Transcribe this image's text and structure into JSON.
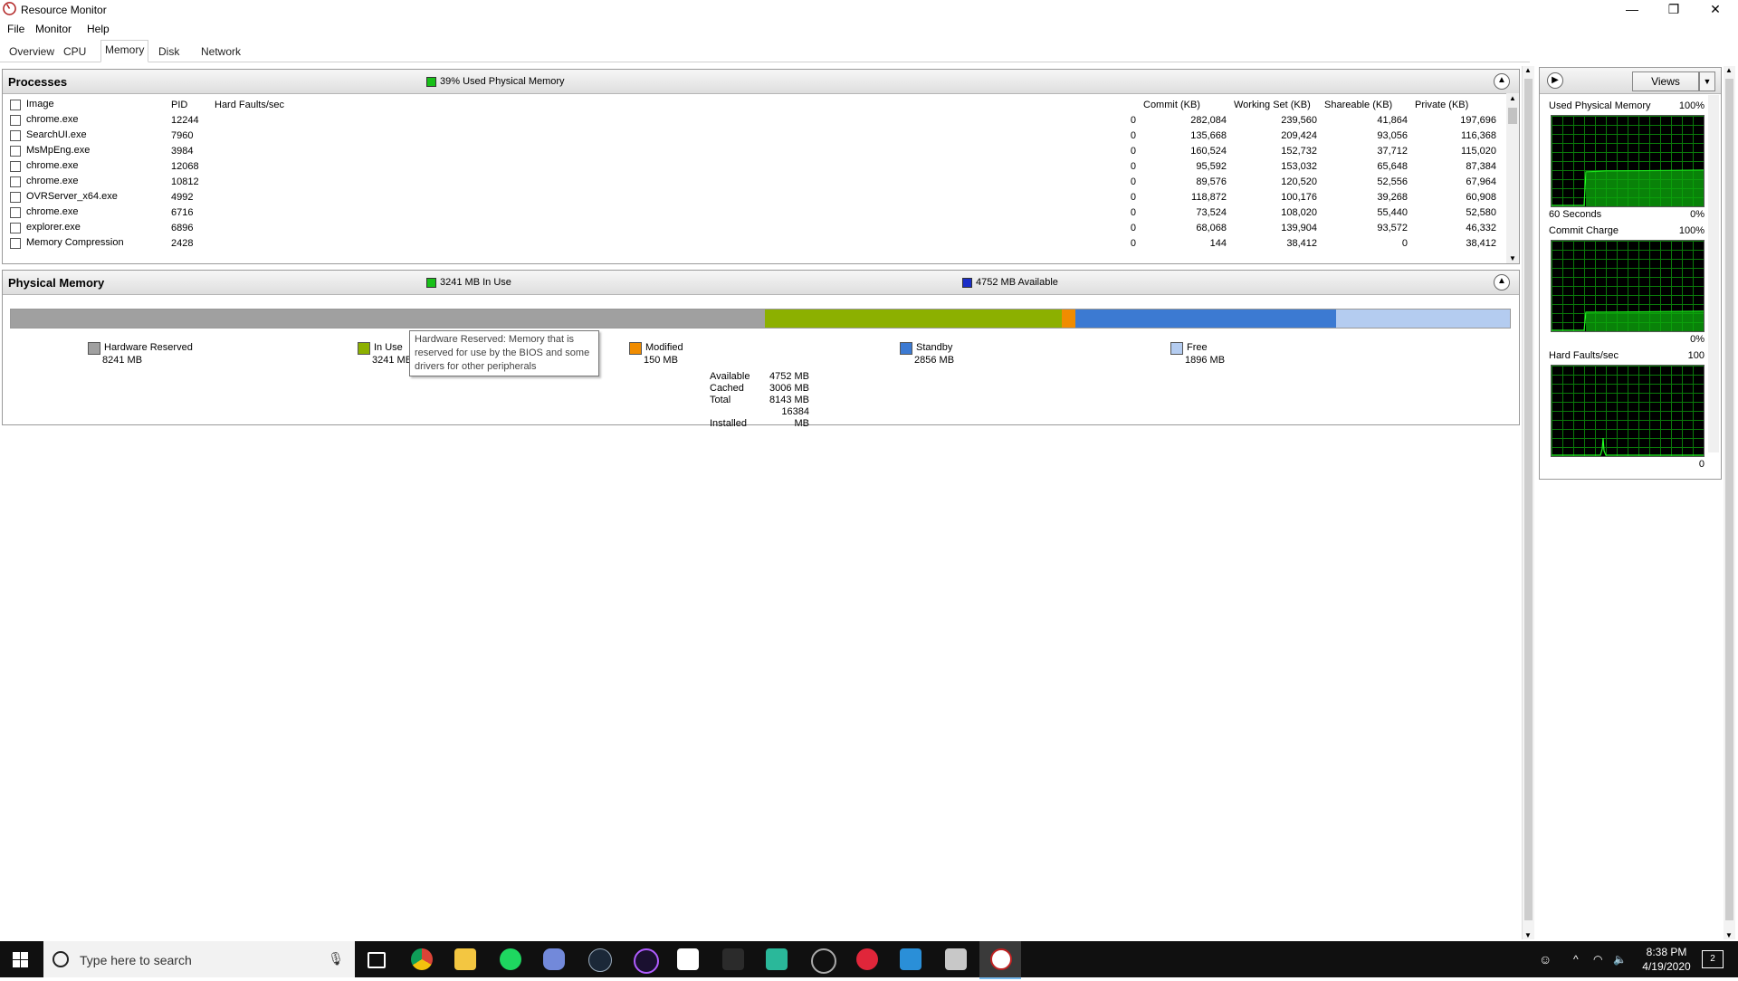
{
  "window": {
    "title": "Resource Monitor",
    "buttons": {
      "minimize": "—",
      "restore": "❐",
      "close": "✕"
    }
  },
  "menu": [
    "File",
    "Monitor",
    "Help"
  ],
  "tabs": [
    "Overview",
    "CPU",
    "Memory",
    "Disk",
    "Network"
  ],
  "active_tab": "Memory",
  "processes": {
    "title": "Processes",
    "status": "39% Used Physical Memory",
    "columns": [
      "Image",
      "PID",
      "Hard Faults/sec",
      "Commit (KB)",
      "Working Set (KB)",
      "Shareable (KB)",
      "Private (KB)"
    ],
    "rows": [
      [
        "chrome.exe",
        "12244",
        "0",
        "282,084",
        "239,560",
        "41,864",
        "197,696"
      ],
      [
        "SearchUI.exe",
        "7960",
        "0",
        "135,668",
        "209,424",
        "93,056",
        "116,368"
      ],
      [
        "MsMpEng.exe",
        "3984",
        "0",
        "160,524",
        "152,732",
        "37,712",
        "115,020"
      ],
      [
        "chrome.exe",
        "12068",
        "0",
        "95,592",
        "153,032",
        "65,648",
        "87,384"
      ],
      [
        "chrome.exe",
        "10812",
        "0",
        "89,576",
        "120,520",
        "52,556",
        "67,964"
      ],
      [
        "OVRServer_x64.exe",
        "4992",
        "0",
        "118,872",
        "100,176",
        "39,268",
        "60,908"
      ],
      [
        "chrome.exe",
        "6716",
        "0",
        "73,524",
        "108,020",
        "55,440",
        "52,580"
      ],
      [
        "explorer.exe",
        "6896",
        "0",
        "68,068",
        "139,904",
        "93,572",
        "46,332"
      ],
      [
        "Memory Compression",
        "2428",
        "0",
        "144",
        "38,412",
        "0",
        "38,412"
      ]
    ]
  },
  "physical_memory": {
    "title": "Physical Memory",
    "in_use_status": "3241 MB In Use",
    "available_status": "4752 MB Available",
    "colors": {
      "hardware_reserved": "#a0a0a0",
      "in_use": "#8cb000",
      "modified": "#f08c00",
      "standby": "#3c7ad2",
      "free": "#b4ccf0"
    },
    "bar_fractions": {
      "hardware_reserved": 0.503,
      "in_use": 0.198,
      "modified": 0.009,
      "standby": 0.174,
      "free": 0.116
    },
    "legend": [
      {
        "key": "hardware_reserved",
        "label": "Hardware Reserved",
        "value": "8241 MB"
      },
      {
        "key": "in_use",
        "label": "In Use",
        "value": "3241 MB"
      },
      {
        "key": "modified",
        "label": "Modified",
        "value": "150 MB"
      },
      {
        "key": "standby",
        "label": "Standby",
        "value": "2856 MB"
      },
      {
        "key": "free",
        "label": "Free",
        "value": "1896 MB"
      }
    ],
    "tooltip": "Hardware Reserved: Memory that is reserved for use by the BIOS and some drivers for other peripherals",
    "summary": [
      {
        "label": "Available",
        "value": "4752 MB"
      },
      {
        "label": "Cached",
        "value": "3006 MB"
      },
      {
        "label": "Total",
        "value": "8143 MB"
      },
      {
        "label": "Installed",
        "value": "16384 MB"
      }
    ]
  },
  "right_pane": {
    "views_label": "Views",
    "graphs": [
      {
        "title": "Used Physical Memory",
        "max": "100%",
        "bottom_left": "60 Seconds",
        "bottom_right": "0%"
      },
      {
        "title": "Commit Charge",
        "max": "100%",
        "bottom_left": "",
        "bottom_right": "0%"
      },
      {
        "title": "Hard Faults/sec",
        "max": "100",
        "bottom_left": "",
        "bottom_right": "0"
      }
    ]
  },
  "taskbar": {
    "search_placeholder": "Type here to search",
    "time": "8:38 PM",
    "date": "4/19/2020",
    "notification_count": "2"
  }
}
